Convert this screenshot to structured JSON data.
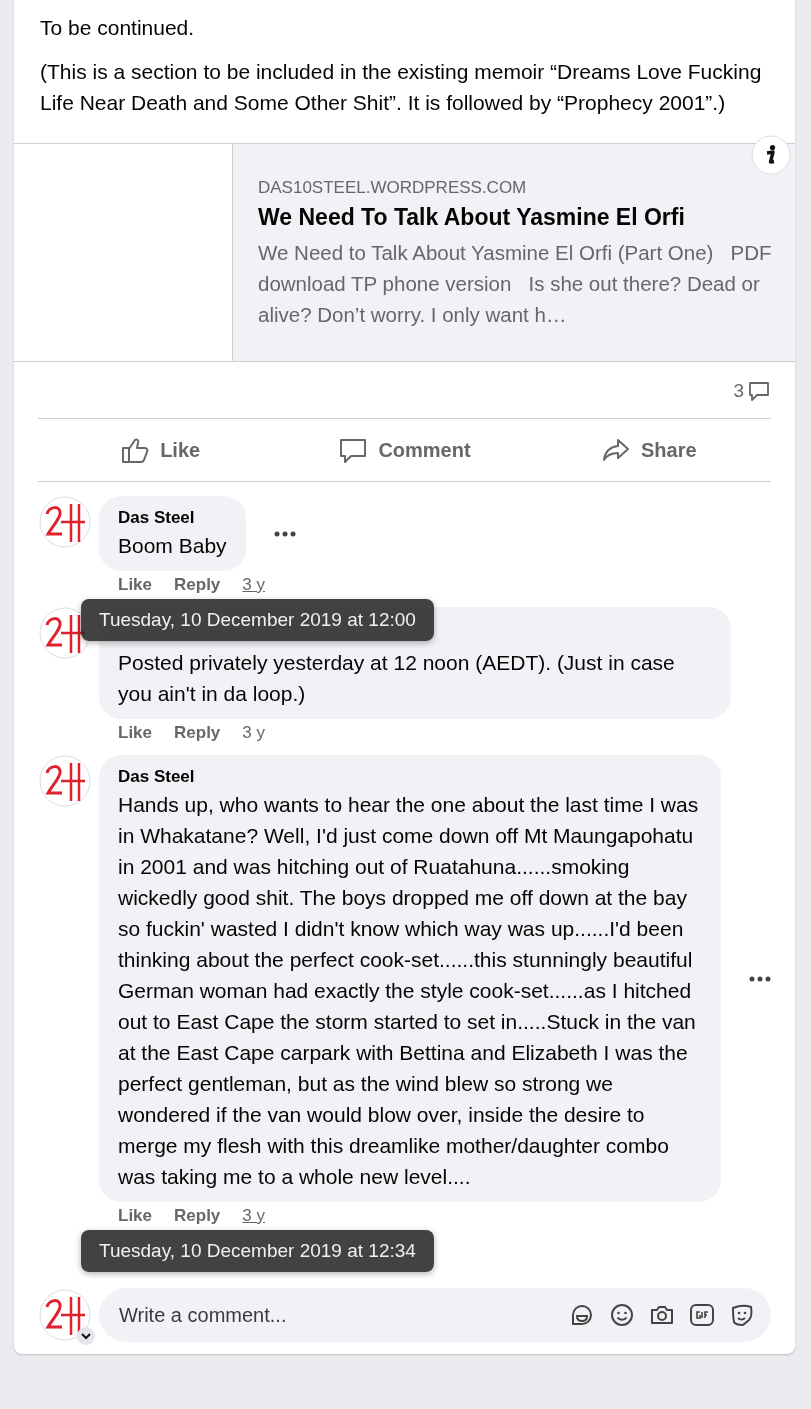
{
  "post_text": [
    "To be continued.",
    "(This is a section to be included in the existing memoir “Dreams Love Fucking Life Near Death and Some Other Shit”. It is followed by “Prophecy 2001”.)"
  ],
  "link_preview": {
    "domain": "DAS10STEEL.WORDPRESS.COM",
    "title": "We Need To Talk About Yasmine El Orfi",
    "description": "We Need to Talk About Yasmine El Orfi (Part One)   PDF download TP phone version   Is she out there? Dead or alive? Don’t worry. I only want h…"
  },
  "comment_count": "3",
  "actions": [
    {
      "label": "Like",
      "kind": "like"
    },
    {
      "label": "Comment",
      "kind": "comment"
    },
    {
      "label": "Share",
      "kind": "share"
    }
  ],
  "comments": [
    {
      "author": "Das Steel",
      "text": "Boom Baby",
      "like": "Like",
      "reply": "Reply",
      "time": "3 y",
      "tooltip": "Tuesday, 10 December 2019 at 12:00"
    },
    {
      "text": "Posted privately yesterday at 12 noon (AEDT). (Just in case you ain't in da loop.)",
      "like": "Like",
      "reply": "Reply",
      "time": "3 y"
    },
    {
      "author": "Das Steel",
      "text": "Hands up, who wants to hear the one about the last time I was in Whakatane? Well, I'd just come down off Mt Maungapohatu in 2001 and was hitching out of Ruatahuna......smoking wickedly good shit. The boys dropped me off down at the bay so fuckin' wasted I didn't know which way was up......I'd been thinking about the perfect cook-set......this stunningly beautiful German woman had exactly the style cook-set......as I hitched out to East Cape the storm started to set in.....Stuck in the van at the East Cape carpark with Bettina and Elizabeth I was the perfect gentleman, but as the wind blew so strong we wondered if the van would blow over, inside the desire to merge my flesh with this dreamlike mother/daughter combo was taking me to a whole new level....",
      "like": "Like",
      "reply": "Reply",
      "time": "3 y",
      "tooltip": "Tuesday, 10 December 2019 at 12:34"
    }
  ],
  "composer": {
    "placeholder": "Write a comment..."
  }
}
